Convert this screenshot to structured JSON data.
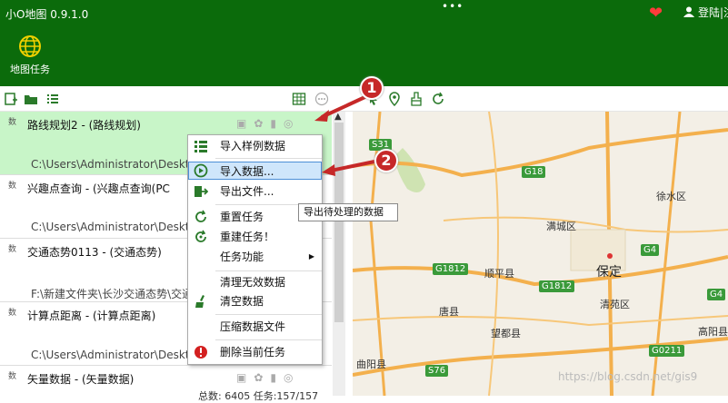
{
  "app": {
    "title": "小O地图 0.9.1.0",
    "menu_dots": "•••",
    "user_label": "登陆|注"
  },
  "ribbon": {
    "map_task_label": "地图任务"
  },
  "tasks": [
    {
      "tag": "数",
      "name": "路线规划2 - (路线规划)",
      "path": "C:\\Users\\Administrator\\Deskt"
    },
    {
      "tag": "数",
      "name": "兴趣点查询 - (兴趣点查询(PC",
      "path": "C:\\Users\\Administrator\\Deskt"
    },
    {
      "tag": "数",
      "name": "交通态势0113 - (交通态势)",
      "path": "F:\\新建文件夹\\长沙交通态势\\交通"
    },
    {
      "tag": "数",
      "name": "计算点距离 - (计算点距离)",
      "path": "C:\\Users\\Administrator\\Deskt"
    },
    {
      "tag": "数",
      "name": "矢量数据 - (矢量数据)",
      "path": ""
    }
  ],
  "footer": {
    "count": "总数: 6405 任务:157/157"
  },
  "context_menu": {
    "items": [
      {
        "label": "导入样例数据"
      },
      {
        "label": "导入数据..."
      },
      {
        "label": "导出文件..."
      },
      {
        "label": "重置任务"
      },
      {
        "label": "重建任务！"
      },
      {
        "label": "任务功能"
      },
      {
        "label": "清理无效数据"
      },
      {
        "label": "清空数据"
      },
      {
        "label": "压缩数据文件"
      },
      {
        "label": "删除当前任务"
      }
    ]
  },
  "tooltip": "导出待处理的数据",
  "badges": {
    "one": "1",
    "two": "2"
  },
  "map": {
    "roads": [
      "S31",
      "G18",
      "G4",
      "G1812",
      "G1812",
      "G4",
      "S76",
      "G0211"
    ],
    "places": [
      "徐水区",
      "满城区",
      "顺平县",
      "清苑区",
      "唐县",
      "望都县",
      "高阳县",
      "曲阳县"
    ],
    "city": "保定"
  },
  "watermark": "https://blog.csdn.net/gis9",
  "colors": {
    "titlebar": "#0b6b0b",
    "selected_row": "#c8f5c8",
    "highlight": "#cfe6fb",
    "badge": "#c62828"
  }
}
